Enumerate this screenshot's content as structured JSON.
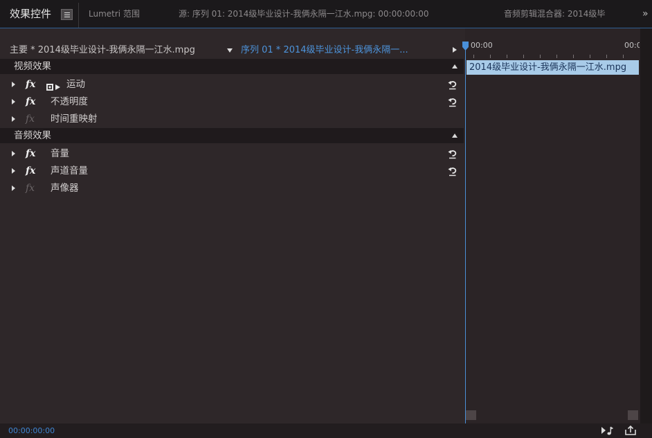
{
  "colors": {
    "accent": "#4a90d9",
    "sequence_text": "#4d94dc",
    "clip_bar": "#a8cbe8",
    "timecode": "#3f86d3"
  },
  "tabs": [
    {
      "label": "效果控件",
      "active": true
    },
    {
      "label": "Lumetri 范围",
      "active": false
    },
    {
      "label": "源: 序列 01: 2014级毕业设计-我俩永隔一江水.mpg: 00:00:00:00",
      "active": false
    },
    {
      "label": "音频剪辑混合器: 2014级毕",
      "active": false
    }
  ],
  "tab_overflow": "»",
  "header": {
    "master_clip": "主要 * 2014级毕业设计-我俩永隔一江水.mpg",
    "sequence_clip": "序列 01 * 2014级毕业设计-我俩永隔一..."
  },
  "sections": {
    "video": {
      "title": "视频效果"
    },
    "audio": {
      "title": "音频效果"
    }
  },
  "video_effects": [
    {
      "fx": "fx",
      "name": "运动",
      "icon": "transform-icon",
      "enabled": true,
      "resettable": true
    },
    {
      "fx": "fx",
      "name": "不透明度",
      "enabled": true,
      "resettable": true
    },
    {
      "fx": "fx",
      "name": "时间重映射",
      "enabled": false,
      "resettable": false
    }
  ],
  "audio_effects": [
    {
      "fx": "fx",
      "name": "音量",
      "enabled": true,
      "resettable": true
    },
    {
      "fx": "fx",
      "name": "声道音量",
      "enabled": true,
      "resettable": true
    },
    {
      "fx": "fx",
      "name": "声像器",
      "enabled": false,
      "resettable": false
    }
  ],
  "timeline": {
    "ruler_start": "00:00",
    "ruler_end": "00:0",
    "clip_name": "2014级毕业设计-我俩永隔一江水.mpg"
  },
  "footer": {
    "timecode": "00:00:00:00",
    "buttons": [
      {
        "icon": "play-audio-only-icon"
      },
      {
        "icon": "export-icon"
      }
    ]
  }
}
